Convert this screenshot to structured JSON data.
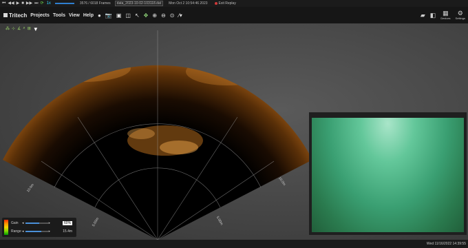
{
  "playback": {
    "speed": "1x",
    "frame_current": "3576",
    "frame_sep": "/",
    "frame_total": "6018",
    "frames_label": "Frames",
    "file_name": "data_2023-10-02-103118.dat",
    "recorded_time": "Mon Oct 2 10:54:46 2023",
    "exit_label": "Exit Replay"
  },
  "menubar": {
    "brand": "Tritech",
    "items": [
      "Projects",
      "Tools",
      "View",
      "Help"
    ],
    "devices_label": "Devices",
    "settings_label": "Settings"
  },
  "sonar": {
    "range_labels": [
      "10.0m",
      "5.00m",
      "5.00m",
      "10.0m"
    ]
  },
  "legend": {
    "gain_label": "Gain",
    "gain_value": "60%",
    "gain_fraction": 0.6,
    "range_label": "Range",
    "range_value": "15.4m",
    "range_fraction": 0.7
  },
  "status": {
    "datetime": "Wed 11/16/2022 14:39:55"
  },
  "colors": {
    "accent": "#2fd3ff",
    "sonar_echo": "#e0a030",
    "camera_water": "#3a9f72"
  }
}
